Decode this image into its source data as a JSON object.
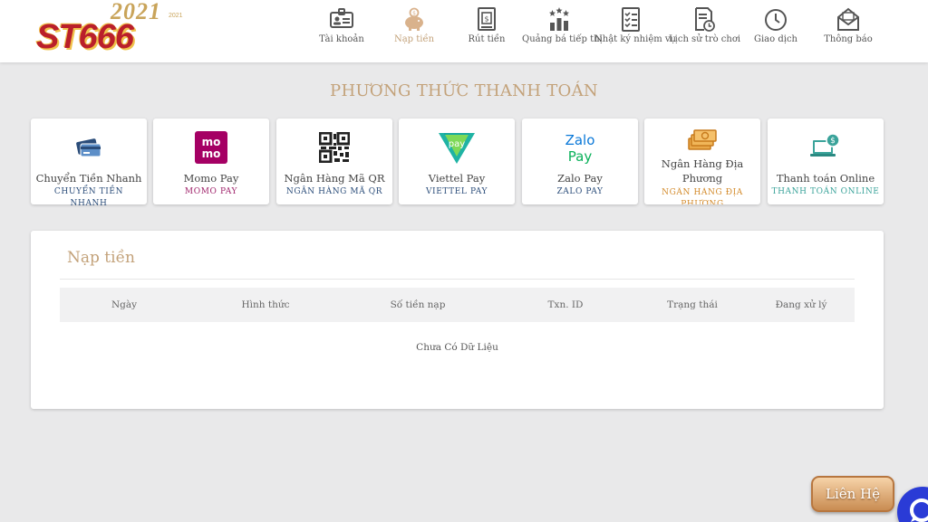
{
  "logo": {
    "brand": "ST666",
    "year": "2021",
    "year_small": "2021"
  },
  "nav": [
    {
      "label": "Tài khoản",
      "icon": "id-card-icon"
    },
    {
      "label": "Nạp tiền",
      "icon": "piggy-bank-icon",
      "active": true
    },
    {
      "label": "Rút tiền",
      "icon": "atm-icon"
    },
    {
      "label": "Quảng bá tiếp thị",
      "icon": "promotion-icon"
    },
    {
      "label": "Nhật ký nhiệm vụ",
      "icon": "checklist-icon"
    },
    {
      "label": "Lịch sử trò chơi",
      "icon": "history-icon"
    },
    {
      "label": "Giao dịch",
      "icon": "clock-icon"
    },
    {
      "label": "Thông báo",
      "icon": "envelope-icon"
    }
  ],
  "page_title": "PHƯƠNG THỨC THANH TOÁN",
  "methods": [
    {
      "name": "Chuyển Tiền Nhanh",
      "sub": "CHUYỂN TIỀN NHANH",
      "sub_color": "#2b4d7a",
      "icon": "cards-icon"
    },
    {
      "name": "Momo Pay",
      "sub": "MOMO PAY",
      "sub_color": "#a0256c",
      "icon": "momo-icon",
      "logo_top": "mo",
      "logo_bottom": "mo"
    },
    {
      "name": "Ngân Hàng Mã QR",
      "sub": "NGÂN HÀNG MÃ QR",
      "sub_color": "#2b4d7a",
      "icon": "qr-code-icon"
    },
    {
      "name": "Viettel Pay",
      "sub": "VIETTEL PAY",
      "sub_color": "#2b4d7a",
      "icon": "viettel-pay-icon",
      "logo_text": "pay"
    },
    {
      "name": "Zalo Pay",
      "sub": "ZALO PAY",
      "sub_color": "#2b4d7a",
      "icon": "zalo-pay-icon",
      "logo_top": "Zalo",
      "logo_bottom": "Pay"
    },
    {
      "name": "Ngân Hàng Địa Phương",
      "sub": "NGÂN HÀNG ĐỊA PHƯƠNG",
      "sub_color": "#d38a2a",
      "icon": "money-stack-icon"
    },
    {
      "name": "Thanh toán Online",
      "sub": "THANH TOÁN ONLINE",
      "sub_color": "#3aa39a",
      "icon": "laptop-payment-icon"
    }
  ],
  "deposit": {
    "title": "Nạp tiền",
    "columns": [
      "Ngày",
      "Hình thức",
      "Số tiền nạp",
      "Txn. ID",
      "Trạng thái",
      "Đang xử lý"
    ],
    "empty_text": "Chưa Có Dữ Liệu"
  },
  "contact_label": "Liên Hệ",
  "colors": {
    "accent": "#c3a27a",
    "background": "#e9e9ea",
    "chat": "#2a3bd6"
  }
}
